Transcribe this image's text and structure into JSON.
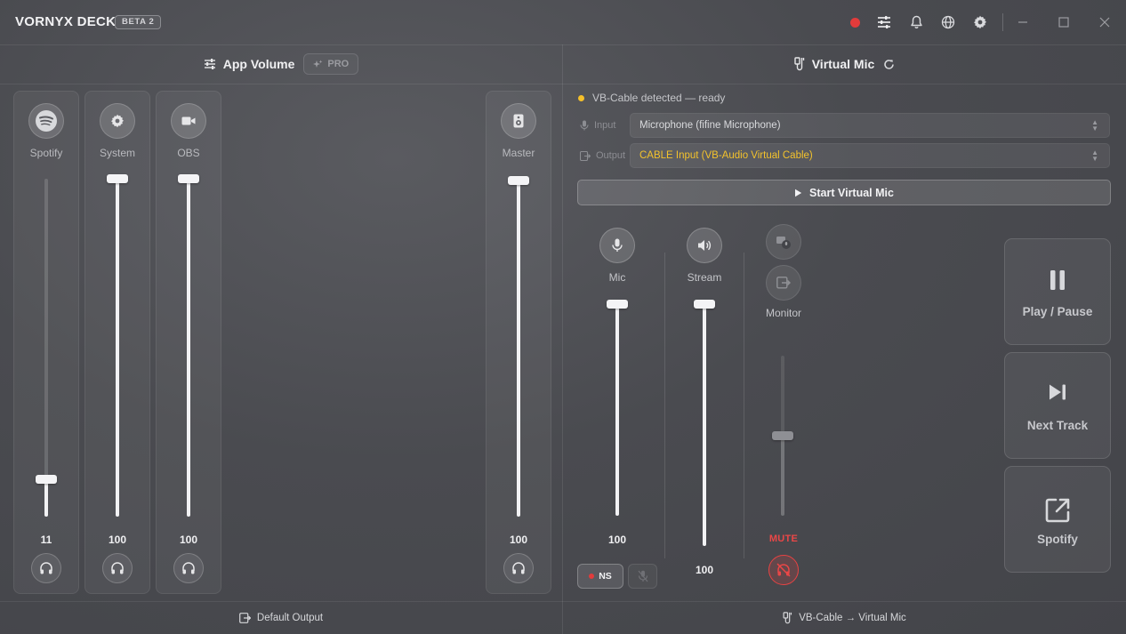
{
  "app": {
    "brand": "VORNYX DECK",
    "badge": "BETA 2"
  },
  "titlebar": {
    "icons": [
      "record-indicator",
      "mixer-icon",
      "bell-icon",
      "globe-icon",
      "gear-icon",
      "minimize-icon",
      "maximize-icon",
      "close-icon"
    ],
    "record_color": "#e23b3b"
  },
  "app_volume": {
    "title": "App Volume",
    "pro_label": "PRO",
    "channels": [
      {
        "name": "Spotify",
        "value": "11",
        "level": 0.11,
        "icon": "spotify-icon"
      },
      {
        "name": "System",
        "value": "100",
        "level": 1.0,
        "icon": "gear-icon"
      },
      {
        "name": "OBS",
        "value": "100",
        "level": 1.0,
        "icon": "camera-icon"
      }
    ],
    "master": {
      "name": "Master",
      "value": "100",
      "level": 1.0,
      "icon": "speaker-icon"
    }
  },
  "virtual_mic": {
    "title": "Virtual Mic",
    "status": "VB-Cable detected — ready",
    "status_color": "#f5c02a",
    "input_label": "Input",
    "input_value": "Microphone (fifine Microphone)",
    "output_label": "Output",
    "output_value": "CABLE Input (VB-Audio Virtual Cable)",
    "output_color": "#f3c22c",
    "start_label": "Start Virtual Mic",
    "mic": {
      "name": "Mic",
      "value": "100",
      "level": 1.0
    },
    "stream": {
      "name": "Stream",
      "value": "100",
      "level": 1.0
    },
    "monitor": {
      "name": "Monitor",
      "level": 0.5,
      "status": "MUTE"
    },
    "ns_label": "NS"
  },
  "media": {
    "play_pause": "Play / Pause",
    "next_track": "Next Track",
    "spotify": "Spotify"
  },
  "footer": {
    "left": "Default Output",
    "right": "VB-Cable → Virtual Mic"
  }
}
